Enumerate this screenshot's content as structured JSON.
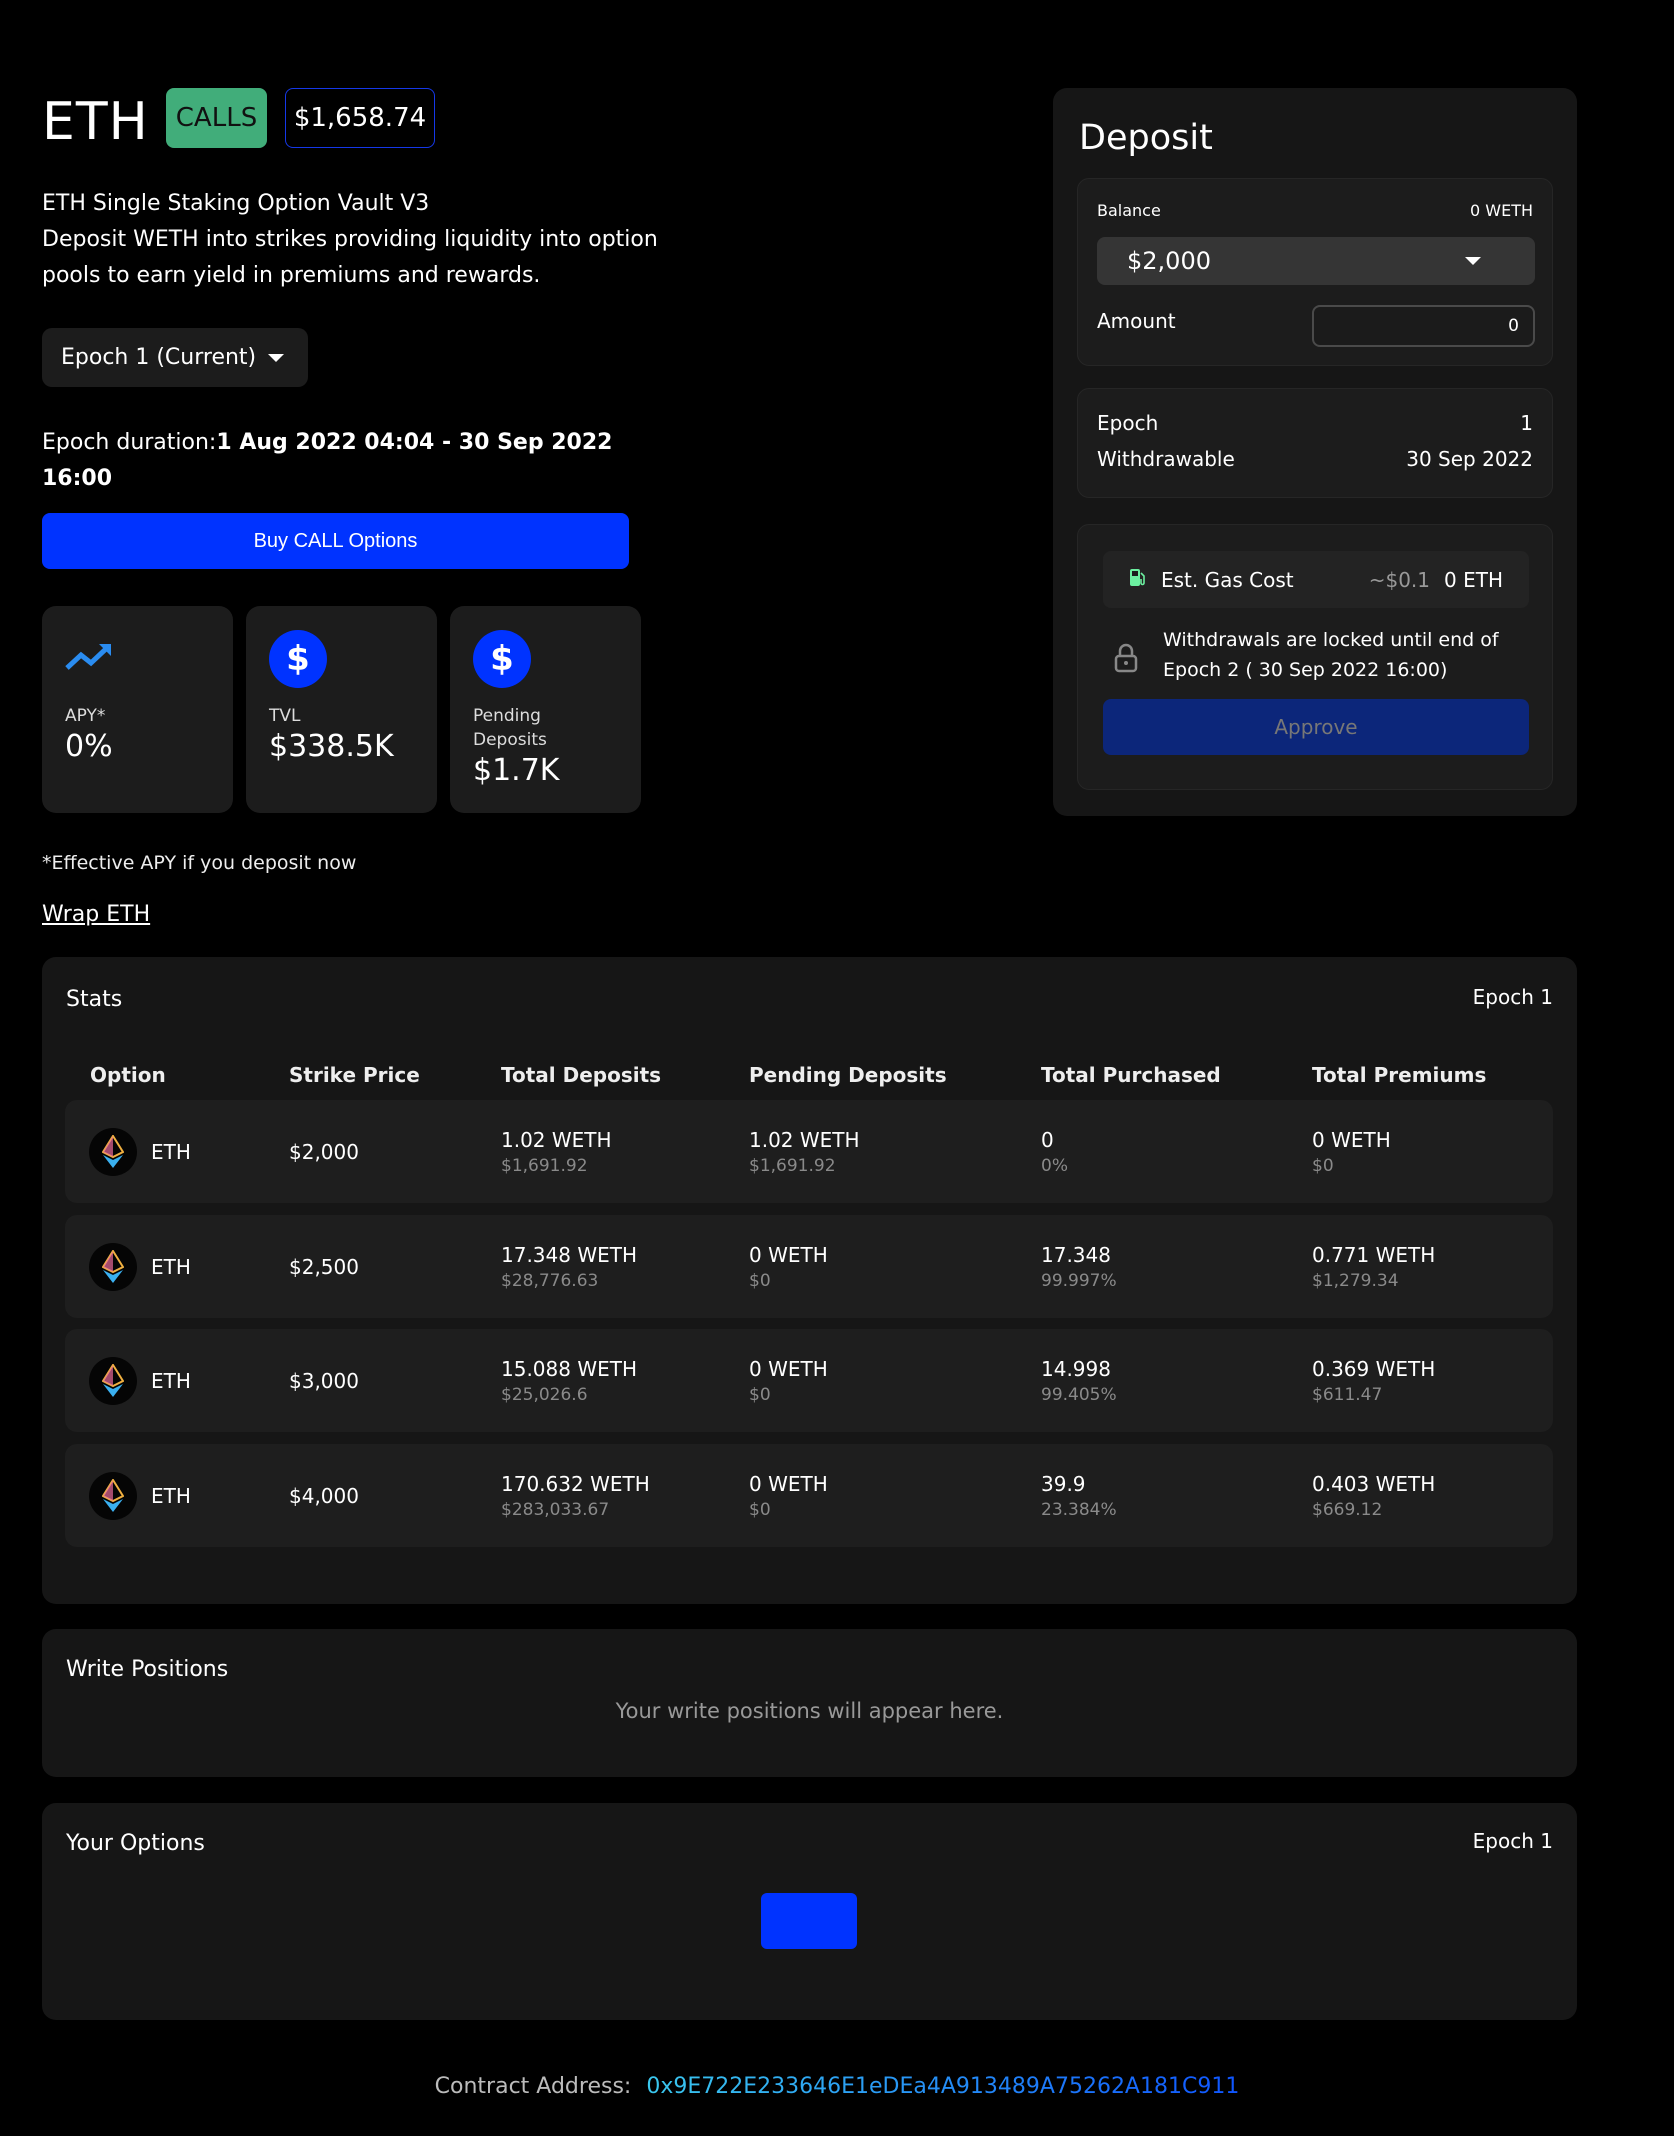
{
  "header": {
    "asset": "ETH",
    "type_badge": "CALLS",
    "price": "$1,658.74"
  },
  "description": {
    "line1": "ETH Single Staking Option Vault V3",
    "line2": "Deposit WETH into strikes providing liquidity into option pools to earn yield in premiums and rewards."
  },
  "epoch_select": {
    "value": "Epoch 1 (Current)"
  },
  "duration": {
    "label": "Epoch duration:",
    "value": "1 Aug 2022 04:04 - 30 Sep 2022 16:00"
  },
  "buy_button": "Buy CALL Options",
  "cards": [
    {
      "label": "APY*",
      "value": "0%",
      "icon": "trending-up-icon"
    },
    {
      "label": "TVL",
      "value": "$338.5K",
      "icon": "dollar-icon"
    },
    {
      "label": "Pending Deposits",
      "value": "$1.7K",
      "icon": "dollar-icon"
    }
  ],
  "apy_note": "*Effective APY if you deposit now",
  "wrap_link": "Wrap ETH",
  "deposit": {
    "title": "Deposit",
    "balance_label": "Balance",
    "balance_value": "0 WETH",
    "strike_select": "$2,000",
    "amount_label": "Amount",
    "amount_value": "0",
    "epoch_label": "Epoch",
    "epoch_value": "1",
    "withdrawable_label": "Withdrawable",
    "withdrawable_value": "30 Sep 2022",
    "gas_label": "Est. Gas Cost",
    "gas_usd": "~$0.1",
    "gas_eth": "0 ETH",
    "lock_text": "Withdrawals are locked until end of Epoch 2 ( 30 Sep 2022 16:00)",
    "approve": "Approve"
  },
  "stats": {
    "title": "Stats",
    "epoch": "Epoch 1",
    "columns": [
      "Option",
      "Strike Price",
      "Total Deposits",
      "Pending Deposits",
      "Total Purchased",
      "Total Premiums"
    ],
    "rows": [
      {
        "option": "ETH",
        "strike": "$2,000",
        "deposits": "1.02 WETH",
        "deposits_usd": "$1,691.92",
        "pending": "1.02 WETH",
        "pending_usd": "$1,691.92",
        "purchased": "0",
        "purchased_pct": "0%",
        "premiums": "0 WETH",
        "premiums_usd": "$0"
      },
      {
        "option": "ETH",
        "strike": "$2,500",
        "deposits": "17.348 WETH",
        "deposits_usd": "$28,776.63",
        "pending": "0 WETH",
        "pending_usd": "$0",
        "purchased": "17.348",
        "purchased_pct": "99.997%",
        "premiums": "0.771 WETH",
        "premiums_usd": "$1,279.34"
      },
      {
        "option": "ETH",
        "strike": "$3,000",
        "deposits": "15.088 WETH",
        "deposits_usd": "$25,026.6",
        "pending": "0 WETH",
        "pending_usd": "$0",
        "purchased": "14.998",
        "purchased_pct": "99.405%",
        "premiums": "0.369 WETH",
        "premiums_usd": "$611.47"
      },
      {
        "option": "ETH",
        "strike": "$4,000",
        "deposits": "170.632 WETH",
        "deposits_usd": "$283,033.67",
        "pending": "0 WETH",
        "pending_usd": "$0",
        "purchased": "39.9",
        "purchased_pct": "23.384%",
        "premiums": "0.403 WETH",
        "premiums_usd": "$669.12"
      }
    ]
  },
  "write_positions": {
    "title": "Write Positions",
    "empty": "Your write positions will appear here."
  },
  "your_options": {
    "title": "Your Options",
    "epoch": "Epoch 1"
  },
  "footer": {
    "label": "Contract Address:",
    "address": "0x9E722E233646E1eDEa4A913489A75262A181C911"
  },
  "colors": {
    "accent": "#0033ff",
    "calls": "#41ad7a",
    "approve_disabled": "#0c267a"
  }
}
